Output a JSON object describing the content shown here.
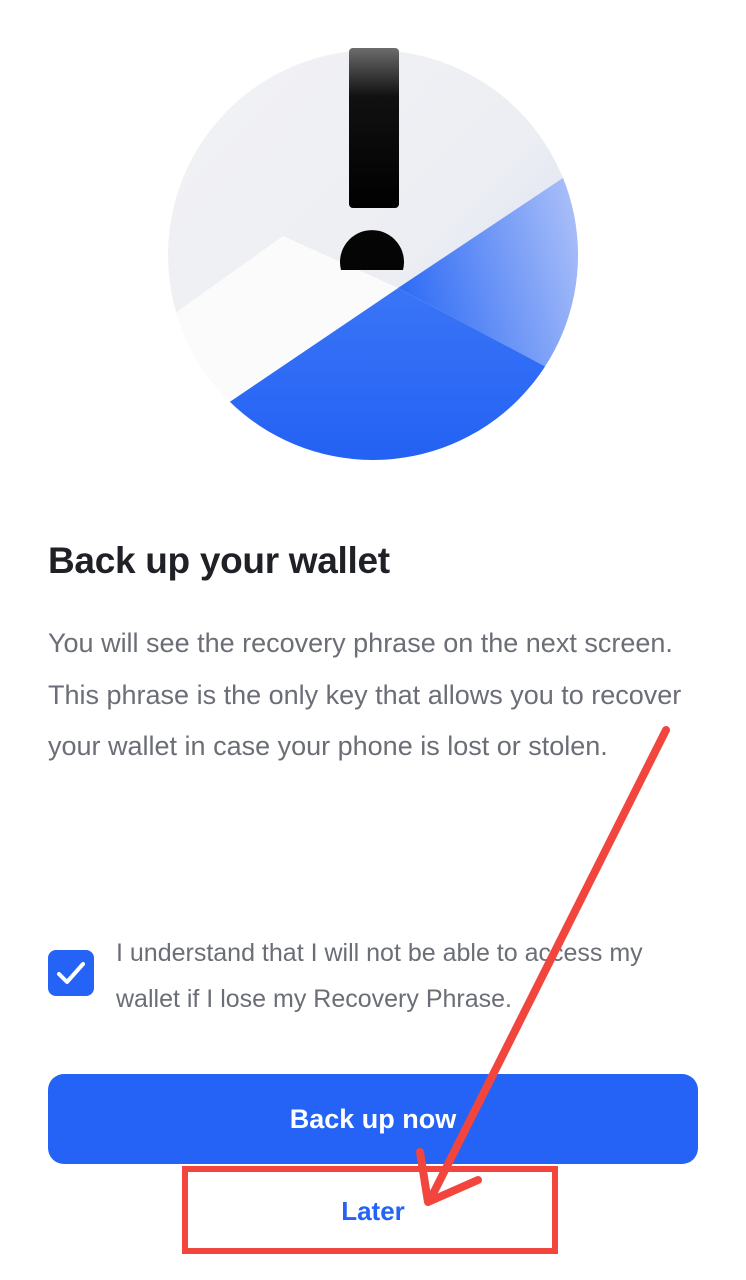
{
  "backup": {
    "title": "Back up your wallet",
    "body": "You will see the recovery phrase on the next screen. This phrase is the only key that allows you to recover your wallet in case your phone is lost or stolen.",
    "consent_text": "I understand that I will not be able to access my wallet if I lose my Recovery Phrase.",
    "consent_checked": true,
    "primary_button_label": "Back up now",
    "secondary_button_label": "Later"
  },
  "illustration": {
    "icon": "exclamation-warning-icon"
  },
  "colors": {
    "accent": "#2463f6",
    "title_text": "#1f2126",
    "body_text": "#6b6e76",
    "annotation": "#f1453d"
  }
}
